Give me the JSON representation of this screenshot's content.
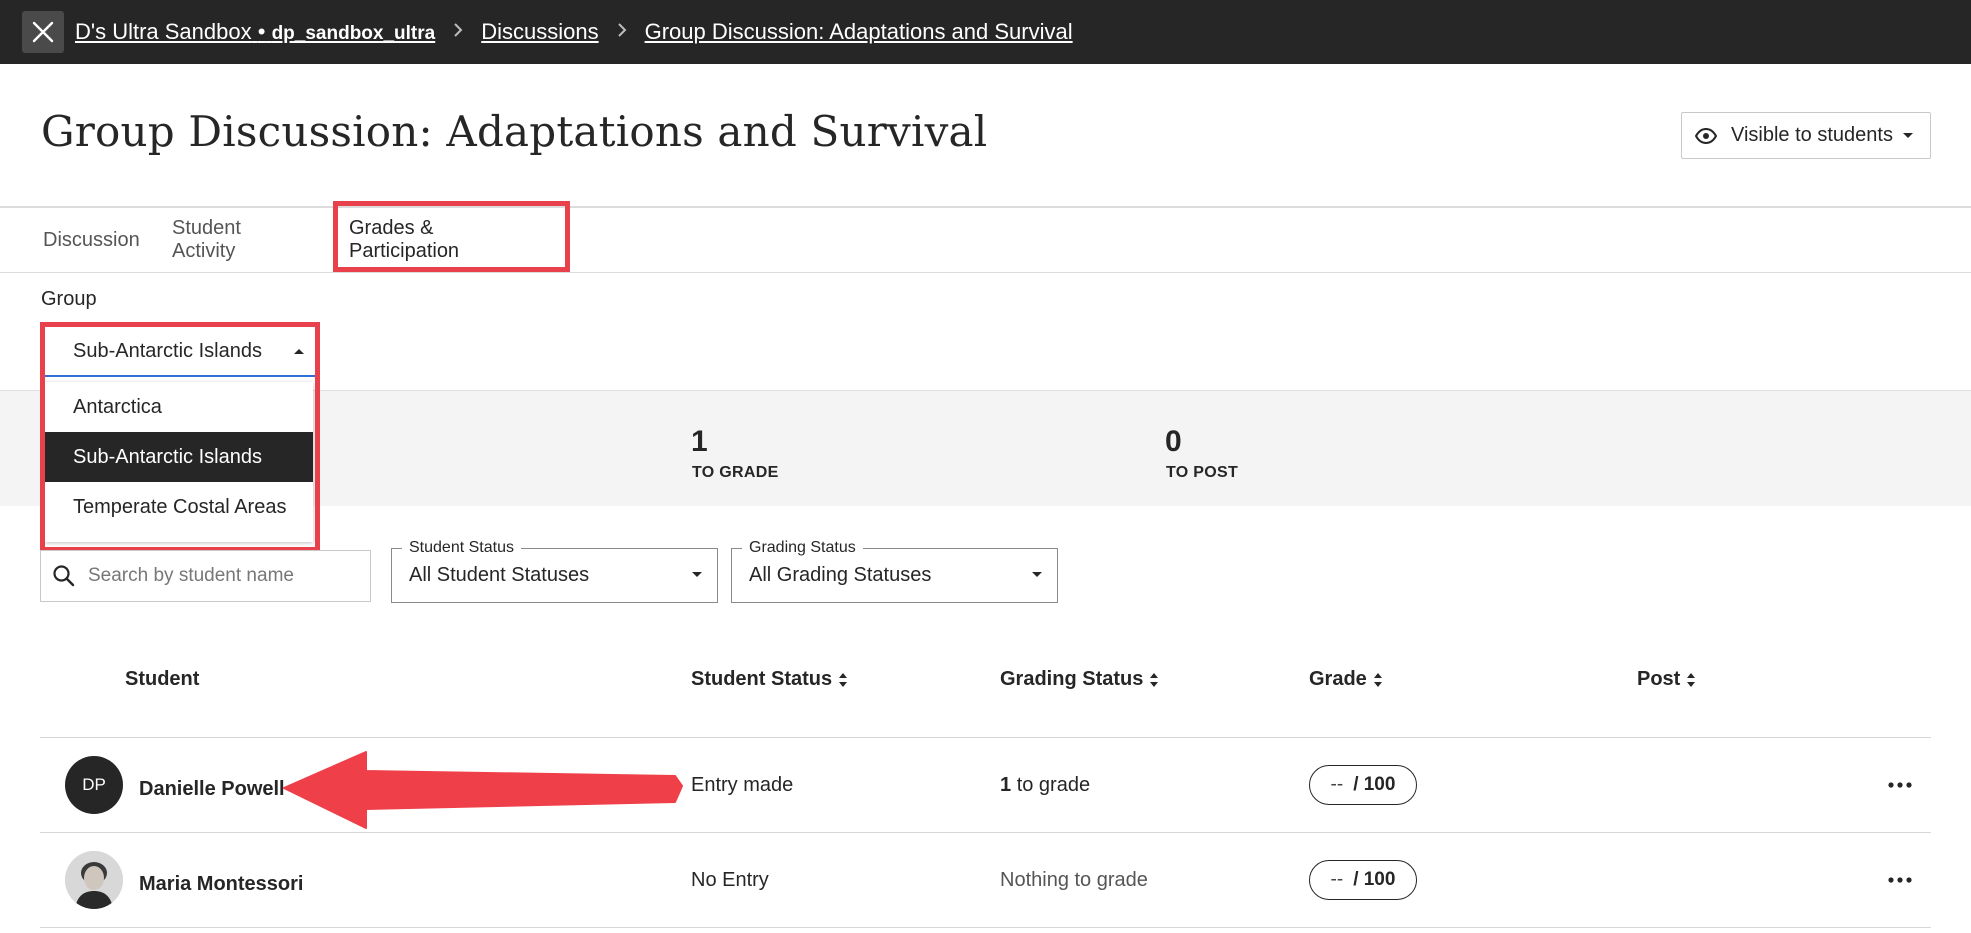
{
  "breadcrumb": {
    "course_name": "D's Ultra Sandbox",
    "course_sep": "•",
    "course_code": "dp_sandbox_ultra",
    "discussions": "Discussions",
    "current": "Group Discussion: Adaptations and Survival"
  },
  "page": {
    "title": "Group Discussion: Adaptations and Survival",
    "visibility_label": "Visible to students"
  },
  "tabs": [
    {
      "label": "Discussion"
    },
    {
      "label": "Student Activity"
    },
    {
      "label": "Grades & Participation",
      "active": true
    }
  ],
  "group": {
    "label": "Group",
    "selected": "Sub-Antarctic Islands",
    "options": [
      "Antarctica",
      "Sub-Antarctic Islands",
      "Temperate Costal Areas"
    ]
  },
  "stats": {
    "to_grade_value": "1",
    "to_grade_label": "TO GRADE",
    "to_post_value": "0",
    "to_post_label": "TO POST"
  },
  "filters": {
    "search_placeholder": "Search by student name",
    "student_status_legend": "Student Status",
    "student_status_value": "All Student Statuses",
    "grading_status_legend": "Grading Status",
    "grading_status_value": "All Grading Statuses"
  },
  "table": {
    "headers": {
      "student": "Student",
      "student_status": "Student Status",
      "grading_status": "Grading Status",
      "grade": "Grade",
      "post": "Post"
    },
    "rows": [
      {
        "initials": "DP",
        "name": "Danielle Powell",
        "student_status": "Entry made",
        "grading_count": "1",
        "grading_text": "to grade",
        "grade_value": "--",
        "grade_max": "/ 100"
      },
      {
        "initials": "",
        "name": "Maria Montessori",
        "student_status": "No Entry",
        "grading_text": "Nothing to grade",
        "grade_value": "--",
        "grade_max": "/ 100"
      }
    ]
  },
  "colors": {
    "topbar": "#262626",
    "highlight": "#e8414b",
    "accent": "#2f6fd6",
    "selected_option_bg": "#262626",
    "summary_bg": "#f4f4f4"
  },
  "icons": [
    "close-icon",
    "chevron-right-icon",
    "eye-icon",
    "caret-down-icon",
    "caret-up-icon",
    "search-icon",
    "sort-icon",
    "more-options-icon",
    "arrow-annotation"
  ]
}
